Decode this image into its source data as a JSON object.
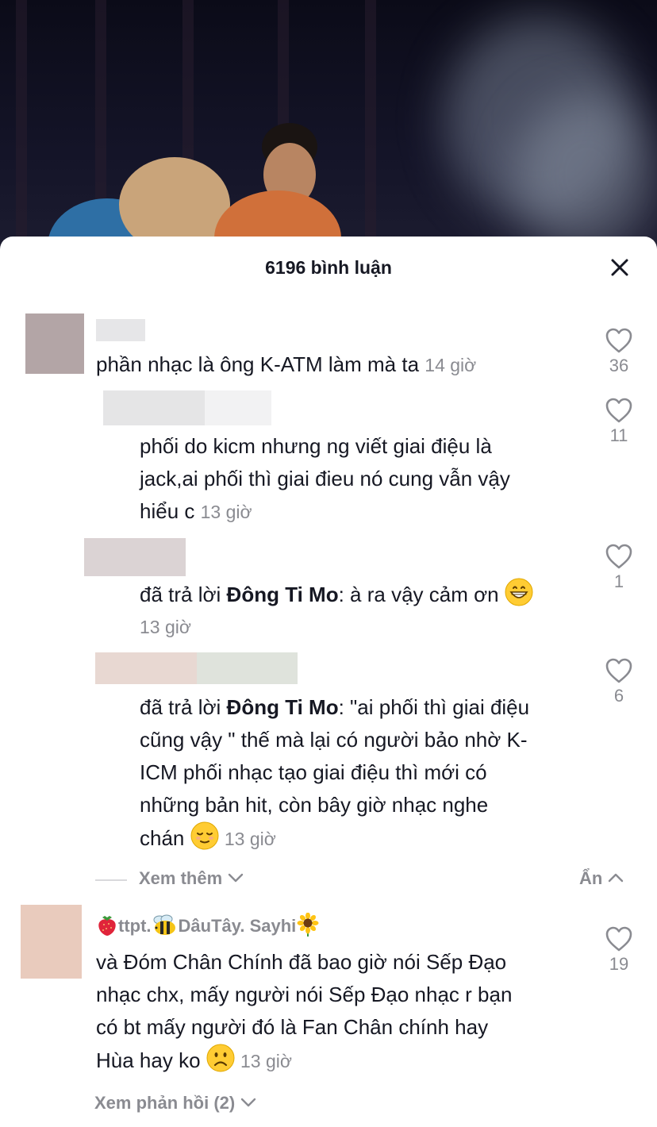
{
  "sheet": {
    "title": "6196 bình luận"
  },
  "comments": [
    {
      "text": "phần nhạc là ông K-ATM làm mà ta",
      "time": "14 giờ",
      "likes": "36"
    },
    {
      "text": "phối do kicm nhưng ng viết giai điệu là jack,ai phối thì giai điеu nó cung vẫn vậy hiểu c",
      "line1": "phối do kicm nhưng ng viết giai điệu là",
      "line2": "jack,ai phối thì giai điеu nó cung vẫn vậy",
      "line3": "hiểu c",
      "time": "13 giờ",
      "likes": "11"
    },
    {
      "prefix": "đã trả lời ",
      "mention": "Đông Ti Mo",
      "text": ": à ra vậy cảm ơn",
      "time": "13 giờ",
      "likes": "1",
      "emoji": "grinning-face"
    },
    {
      "prefix": "đã trả lời ",
      "mention": "Đông Ti Mo",
      "line1": ": \"ai phối thì giai điệu",
      "line2": "cũng vậy \" thế mà lại có người bảo nhờ K-",
      "line3": "ICM phối nhạc tạo giai điệu thì mới có",
      "line4": "những bản hit, còn bây giờ nhạc nghe",
      "line5": "chán",
      "time": "13 giờ",
      "likes": "6",
      "emoji": "relieved-face"
    },
    {
      "username_part1": "ttpt.",
      "username_part2": "DâuTây. Sayhi",
      "line1": "và Đóm Chân Chính đã bao giờ nói Sếp Đạo",
      "line2": "nhạc chx, mấy người nói Sếp Đạo nhạc r bạn",
      "line3": "có bt mấy người đó là Fan Chân chính hay",
      "line4": "Hùa hay ko",
      "time": "13 giờ",
      "likes": "19",
      "emoji": "slightly-frowning-face"
    }
  ],
  "replies_controls": {
    "view_more": "Xem thêm",
    "hide": "Ẩn",
    "view_replies": "Xem phản hồi (2)"
  },
  "icons": {
    "close": "close-icon",
    "like": "heart-outline-icon",
    "chevron_down": "chevron-down-icon",
    "chevron_up": "chevron-up-icon"
  },
  "colors": {
    "text": "#161823",
    "muted": "#8a8b91",
    "sheet_bg": "#ffffff"
  }
}
